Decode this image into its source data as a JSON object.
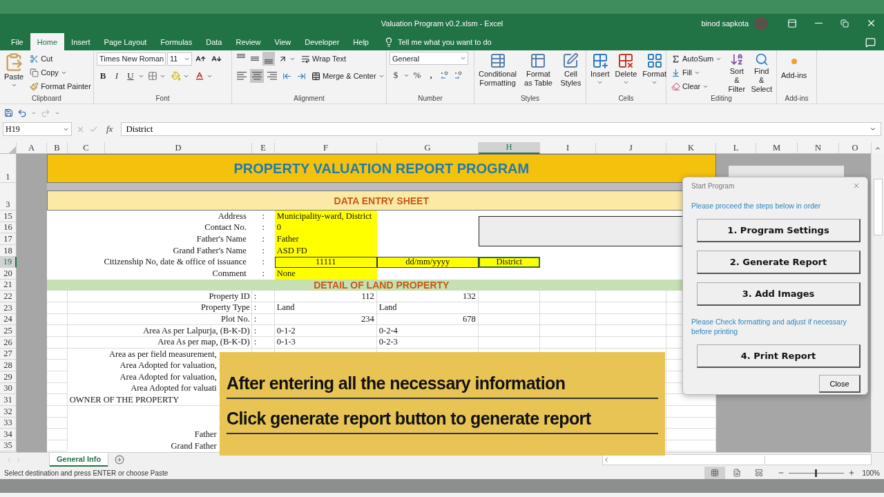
{
  "window": {
    "title": "Valuation Program v0.2.xlsm  -  Excel",
    "user": "binod sapkota"
  },
  "menu_tabs": [
    {
      "label": "File",
      "selected": false
    },
    {
      "label": "Home",
      "selected": true
    },
    {
      "label": "Insert",
      "selected": false
    },
    {
      "label": "Page Layout",
      "selected": false
    },
    {
      "label": "Formulas",
      "selected": false
    },
    {
      "label": "Data",
      "selected": false
    },
    {
      "label": "Review",
      "selected": false
    },
    {
      "label": "View",
      "selected": false
    },
    {
      "label": "Developer",
      "selected": false
    },
    {
      "label": "Help",
      "selected": false
    }
  ],
  "tell_me": "Tell me what you want to do",
  "ribbon": {
    "clipboard": {
      "paste": "Paste",
      "cut": "Cut",
      "copy": "Copy",
      "format_painter": "Format Painter",
      "label": "Clipboard"
    },
    "font": {
      "name": "Times New Roman",
      "size": "11",
      "bold": "B",
      "italic": "I",
      "underline": "U",
      "label": "Font"
    },
    "alignment": {
      "vertical": [
        {
          "selected": false
        },
        {
          "selected": false
        },
        {
          "selected": true
        }
      ],
      "horizontal": [
        {
          "selected": false
        },
        {
          "selected": true
        },
        {
          "selected": false
        }
      ],
      "wrap": "Wrap Text",
      "merge": "Merge & Center",
      "label": "Alignment"
    },
    "number": {
      "format": "General",
      "currency": "$",
      "percent": "%",
      "comma": ",",
      "label": "Number"
    },
    "styles": {
      "items": [
        "Conditional Formatting",
        "Format as Table",
        "Cell Styles"
      ],
      "label": "Styles"
    },
    "cells": {
      "items": [
        "Insert",
        "Delete",
        "Format"
      ],
      "label": "Cells"
    },
    "editing": {
      "autosum": "AutoSum",
      "fill": "Fill",
      "clear": "Clear",
      "sort": "Sort & Filter",
      "find": "Find & Select",
      "label": "Editing"
    },
    "addins": {
      "button": "Add-ins",
      "label": "Add-ins"
    }
  },
  "formula_bar": {
    "name_box": "H19",
    "fx": "fx",
    "value": "District"
  },
  "columns": [
    {
      "label": "A",
      "selected": false
    },
    {
      "label": "B",
      "selected": false
    },
    {
      "label": "C",
      "selected": false
    },
    {
      "label": "D",
      "selected": false
    },
    {
      "label": "E",
      "selected": false
    },
    {
      "label": "F",
      "selected": false
    },
    {
      "label": "G",
      "selected": false
    },
    {
      "label": "H",
      "selected": true
    },
    {
      "label": "I",
      "selected": false
    },
    {
      "label": "J",
      "selected": false
    },
    {
      "label": "K",
      "selected": false
    },
    {
      "label": "L",
      "selected": false
    },
    {
      "label": "M",
      "selected": false
    },
    {
      "label": "N",
      "selected": false
    },
    {
      "label": "O",
      "selected": false
    }
  ],
  "sheet": {
    "rows": [
      {
        "num": "1",
        "kind": "title",
        "selected": false,
        "label": "PROPERTY VALUATION REPORT PROGRAM"
      },
      {
        "num": "3",
        "kind": "subtitle",
        "selected": false,
        "label": "DATA ENTRY SHEET"
      },
      {
        "num": "15",
        "kind": "entry",
        "selected": false,
        "label": "Address",
        "separator": ":",
        "values": [
          {
            "text": "Municipality-ward, District"
          }
        ]
      },
      {
        "num": "16",
        "kind": "entry",
        "selected": false,
        "label": "Contact No.",
        "separator": ":",
        "values": [
          {
            "text": "0"
          }
        ]
      },
      {
        "num": "17",
        "kind": "entry",
        "selected": false,
        "label": "Father's Name",
        "separator": ":",
        "values": [
          {
            "text": "Father"
          }
        ]
      },
      {
        "num": "18",
        "kind": "entry",
        "selected": false,
        "label": "Grand Father's Name",
        "separator": ":",
        "values": [
          {
            "text": "ASD FD"
          }
        ]
      },
      {
        "num": "19",
        "kind": "entry-triple",
        "selected": true,
        "label": "Citizenship No, date & office of issuance",
        "separator": ":",
        "values": [
          {
            "text": "11111",
            "selected": false
          },
          {
            "text": "dd/mm/yyyy",
            "selected": false
          },
          {
            "text": "District",
            "selected": true
          }
        ]
      },
      {
        "num": "20",
        "kind": "entry",
        "selected": false,
        "label": "Comment",
        "separator": ":",
        "values": [
          {
            "text": "None"
          }
        ]
      },
      {
        "num": "21",
        "kind": "section",
        "selected": false,
        "label": "DETAIL OF LAND PROPERTY"
      },
      {
        "num": "22",
        "kind": "detail-numeric",
        "selected": false,
        "label": "Property ID",
        "separator": ":",
        "values": [
          {
            "text": "112"
          },
          {
            "text": "132"
          }
        ]
      },
      {
        "num": "23",
        "kind": "detail",
        "selected": false,
        "label": "Property Type",
        "separator": ":",
        "values": [
          {
            "text": "Land"
          },
          {
            "text": "Land"
          }
        ]
      },
      {
        "num": "24",
        "kind": "detail-numeric",
        "selected": false,
        "label": "Plot No.",
        "separator": ":",
        "values": [
          {
            "text": "234"
          },
          {
            "text": "678"
          }
        ]
      },
      {
        "num": "25",
        "kind": "detail",
        "selected": false,
        "label": "Area As per Lalpurja, (B-K-D)",
        "separator": ":",
        "values": [
          {
            "text": "0-1-2"
          },
          {
            "text": "0-2-4"
          }
        ]
      },
      {
        "num": "26",
        "kind": "detail",
        "selected": false,
        "label": "Area As  per map, (B-K-D)",
        "separator": ":",
        "values": [
          {
            "text": "0-1-3"
          },
          {
            "text": "0-2-3"
          }
        ]
      },
      {
        "num": "27",
        "kind": "covered",
        "selected": false,
        "label": "Area as per field  measurement,"
      },
      {
        "num": "28",
        "kind": "covered",
        "selected": false,
        "label": "Area Adopted for valuation,"
      },
      {
        "num": "29",
        "kind": "covered",
        "selected": false,
        "label": "Area Adopted for valuation,"
      },
      {
        "num": "30",
        "kind": "covered",
        "selected": false,
        "label": "Area Adopted for valuati"
      },
      {
        "num": "31",
        "kind": "heading-left",
        "selected": false,
        "label": "OWNER OF THE PROPERTY"
      },
      {
        "num": "32",
        "kind": "covered",
        "selected": false
      },
      {
        "num": "33",
        "kind": "covered",
        "selected": false
      },
      {
        "num": "34",
        "kind": "covered",
        "selected": false,
        "label": "Father"
      },
      {
        "num": "35",
        "kind": "covered",
        "selected": false,
        "label": "Grand Father"
      }
    ]
  },
  "caption": {
    "lines": [
      "After entering all the necessary information",
      "Click generate report button to generate report"
    ]
  },
  "dialog": {
    "title": "Start Program",
    "items": [
      {
        "kind": "note",
        "text": "Please proceed the steps below in order"
      },
      {
        "kind": "button",
        "text": "1. Program Settings"
      },
      {
        "kind": "button",
        "text": "2. Generate Report"
      },
      {
        "kind": "button",
        "text": "3. Add Images"
      },
      {
        "kind": "note",
        "text": "Please Check formatting and adjust if necessary before printing"
      },
      {
        "kind": "button",
        "text": "4. Print Report"
      }
    ],
    "close": "Close"
  },
  "sheet_tabs": [
    {
      "label": "General Info",
      "selected": true
    }
  ],
  "status_bar": {
    "message": "Select destination and press ENTER or choose Paste",
    "views": [
      {
        "selected": true
      },
      {
        "selected": false
      },
      {
        "selected": false
      }
    ],
    "zoom": {
      "level": 0.5,
      "reading": "100%"
    }
  }
}
